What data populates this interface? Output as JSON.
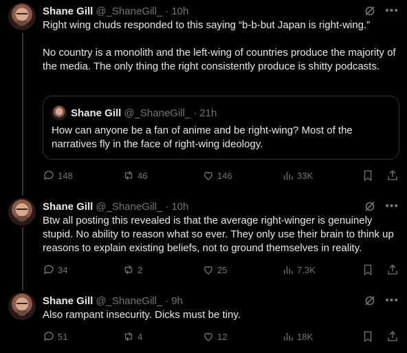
{
  "tweets": [
    {
      "name": "Shane Gill",
      "handle": "@_ShaneGill_",
      "sep": "·",
      "time": "10h",
      "text": "Right wing chuds responded to this saying “b-b-but Japan is right-wing.”\n\nNo country is a monolith and the left-wing of countries produce the majority of the media. The only thing the right consistently produce is shitty podcasts.",
      "quote": {
        "name": "Shane Gill",
        "handle": "@_ShaneGill_",
        "sep": "·",
        "time": "21h",
        "text": "How can anyone be a fan of anime and be right-wing? Most of the narratives fly in the face of right-wing ideology."
      },
      "replies": "148",
      "reposts": "46",
      "likes": "146",
      "views": "33K"
    },
    {
      "name": "Shane Gill",
      "handle": "@_ShaneGill_",
      "sep": "·",
      "time": "10h",
      "text": "Btw all posting this revealed is that the average right-winger is genuinely stupid. No ability to reason what so ever. They only use their brain to think up reasons to explain existing beliefs, not to ground themselves in reality.",
      "replies": "34",
      "reposts": "2",
      "likes": "25",
      "views": "7.3K"
    },
    {
      "name": "Shane Gill",
      "handle": "@_ShaneGill_",
      "sep": "·",
      "time": "9h",
      "text": "Also rampant insecurity. Dicks must be tiny.",
      "replies": "51",
      "reposts": "4",
      "likes": "12",
      "views": "18K"
    }
  ],
  "colors": {
    "background": "#000000",
    "text": "#e7e9ea",
    "secondary": "#71767b",
    "border": "#2f3336"
  },
  "icons": [
    "grok-icon",
    "more-icon",
    "reply-icon",
    "repost-icon",
    "like-icon",
    "views-icon",
    "bookmark-icon",
    "share-icon"
  ]
}
